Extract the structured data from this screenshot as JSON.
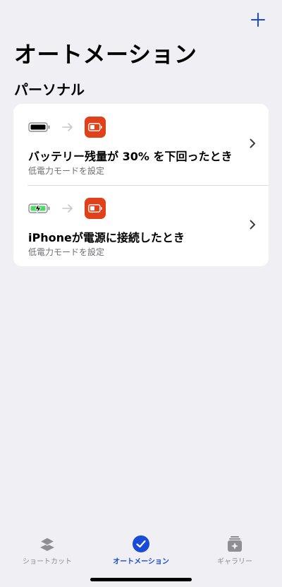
{
  "page": {
    "title": "オートメーション",
    "section_title": "パーソナル"
  },
  "automations": [
    {
      "title": "バッテリー残量が 30% を下回ったとき",
      "subtitle": "低電力モードを設定",
      "trigger_icon": "battery-empty-icon",
      "action_icon": "low-power-mode-icon"
    },
    {
      "title": "iPhoneが電源に接続したとき",
      "subtitle": "低電力モードを設定",
      "trigger_icon": "battery-charging-icon",
      "action_icon": "low-power-mode-icon"
    }
  ],
  "tab_bar": {
    "tabs": [
      {
        "label": "ショートカット",
        "icon": "stack-icon",
        "active": false
      },
      {
        "label": "オートメーション",
        "icon": "clock-check-icon",
        "active": true
      },
      {
        "label": "ギャラリー",
        "icon": "gallery-icon",
        "active": false
      }
    ]
  },
  "colors": {
    "accent": "#1a4bd8",
    "action_icon_bg": "#e0411b",
    "background": "#efeff4",
    "battery_green": "#4cd964"
  }
}
